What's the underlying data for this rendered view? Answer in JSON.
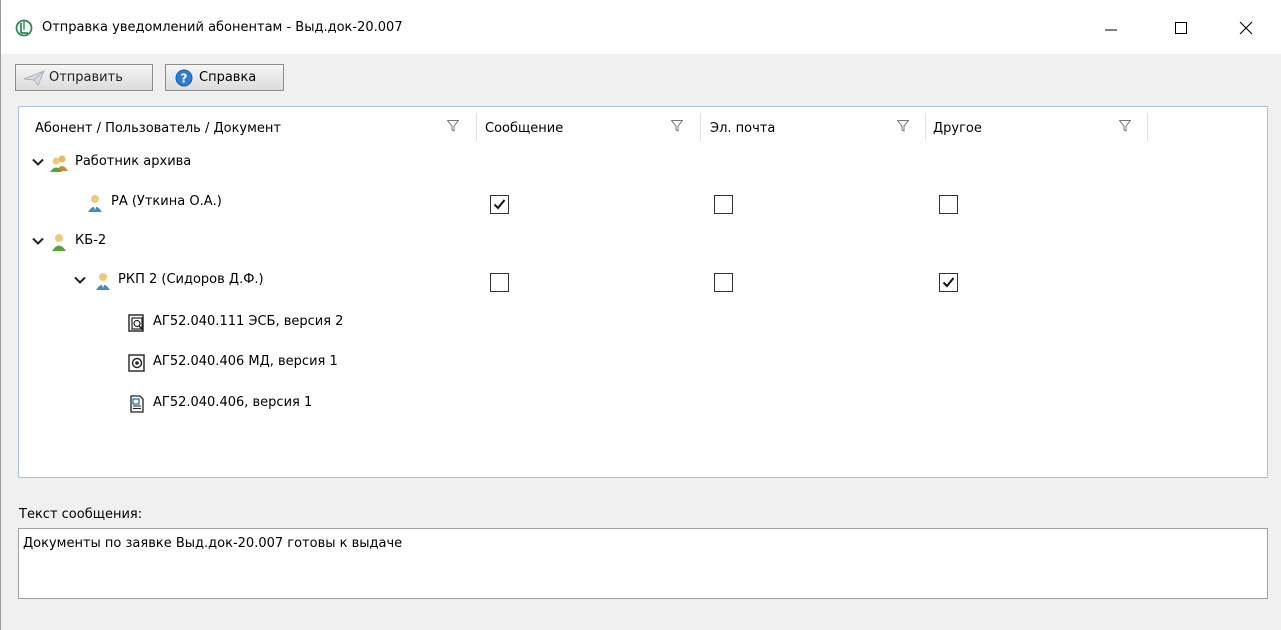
{
  "window": {
    "title": "Отправка уведомлений абонентам - Выд.док-20.007"
  },
  "toolbar": {
    "send_label": "Отправить",
    "help_label": "Справка"
  },
  "grid": {
    "columns": [
      "Абонент / Пользователь / Документ",
      "Сообщение",
      "Эл. почта",
      "Другое"
    ],
    "rows": [
      {
        "label": "Работник архива",
        "icon": "group-icon",
        "expanded": true
      },
      {
        "label": "РА (Уткина О.А.)",
        "icon": "user-icon",
        "message": true,
        "email": false,
        "other": false
      },
      {
        "label": "КБ-2",
        "icon": "department-icon",
        "expanded": true
      },
      {
        "label": "РКП 2 (Сидоров Д.Ф.)",
        "icon": "user-icon",
        "expanded": true,
        "message": false,
        "email": false,
        "other": true
      },
      {
        "label": "АГ52.040.111 ЭСБ, версия 2",
        "icon": "assembly-document-icon"
      },
      {
        "label": "АГ52.040.406 МД, версия 1",
        "icon": "part-document-icon"
      },
      {
        "label": "АГ52.040.406, версия 1",
        "icon": "drawing-document-icon"
      }
    ]
  },
  "message": {
    "label": "Текст сообщения:",
    "text": "Документы по заявке Выд.док-20.007 готовы к выдаче"
  },
  "colors": {
    "grid_border": "#a9c4dc",
    "window_bg": "#f0f0f0",
    "app_icon": "#2e8b57"
  }
}
